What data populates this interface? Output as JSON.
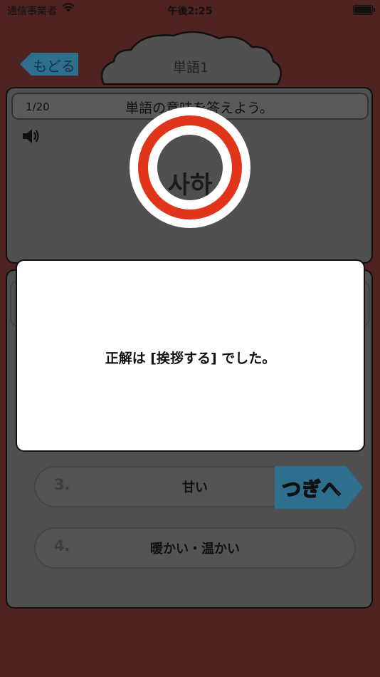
{
  "status_bar": {
    "carrier": "通信事業者",
    "time": "午後2:25"
  },
  "header": {
    "back_label": "もどる",
    "title": "単語1"
  },
  "question": {
    "counter": "1/20",
    "prompt": "単語の意味を答えよう。",
    "word": "사하"
  },
  "options": [
    {
      "number": "3.",
      "label": "甘い"
    },
    {
      "number": "4.",
      "label": "暖かい・温かい"
    }
  ],
  "next_label": "つぎへ",
  "dialog": {
    "message": "正解は [挨拶する] でした。"
  },
  "colors": {
    "background": "#4e2322",
    "panel": "#505050",
    "accent_teal": "#2e6f8e",
    "maru_red": "#e0351a"
  }
}
